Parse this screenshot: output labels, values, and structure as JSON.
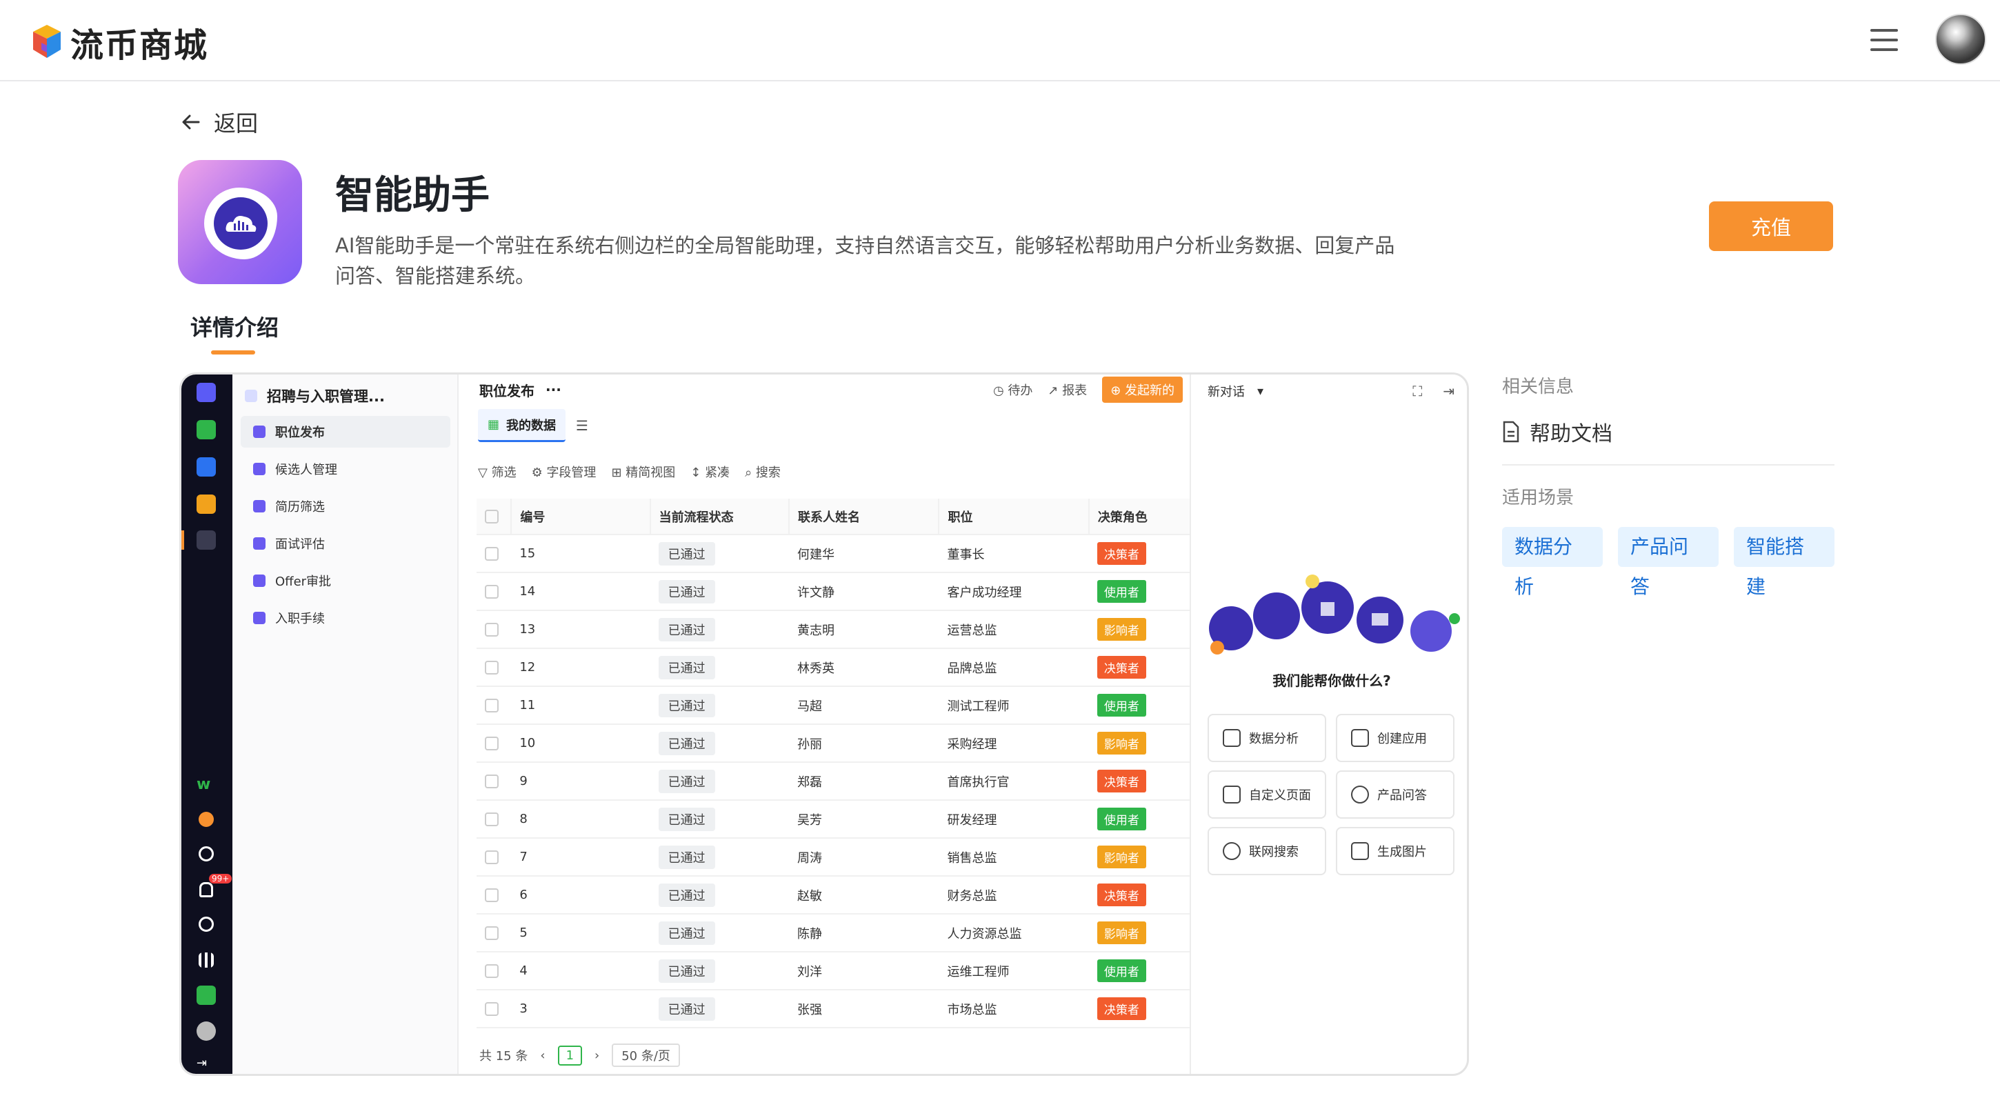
{
  "header": {
    "brand": "流币商城"
  },
  "back": {
    "label": "返回"
  },
  "app": {
    "title": "智能助手",
    "description": "AI智能助手是一个常驻在系统右侧边栏的全局智能助理，支持自然语言交互，能够轻松帮助用户分析业务数据、回复产品问答、智能搭建系统。",
    "recharge_label": "充值"
  },
  "tabs": {
    "detail": "详情介绍"
  },
  "side": {
    "related_heading": "相关信息",
    "doc_link": "帮助文档",
    "scene_heading": "适用场景",
    "tags": [
      "数据分析",
      "产品问答",
      "智能搭建"
    ]
  },
  "screenshot": {
    "nav_title": "招聘与入职管理...",
    "nav_items": [
      "职位发布",
      "候选人管理",
      "简历筛选",
      "面试评估",
      "Offer审批",
      "入职手续"
    ],
    "rail_badge": "99+",
    "page_title": "职位发布",
    "more": "···",
    "tools": {
      "todo": "待办",
      "report": "报表",
      "new": "发起新的"
    },
    "tab_my": "我的数据",
    "filters": [
      "筛选",
      "字段管理",
      "精简视图",
      "紧凑",
      "搜索"
    ],
    "columns": [
      "编号",
      "当前流程状态",
      "联系人姓名",
      "职位",
      "决策角色"
    ],
    "rows": [
      [
        "15",
        "已通过",
        "何建华",
        "董事长",
        "决策者"
      ],
      [
        "14",
        "已通过",
        "许文静",
        "客户成功经理",
        "使用者"
      ],
      [
        "13",
        "已通过",
        "黄志明",
        "运营总监",
        "影响者"
      ],
      [
        "12",
        "已通过",
        "林秀英",
        "品牌总监",
        "决策者"
      ],
      [
        "11",
        "已通过",
        "马超",
        "测试工程师",
        "使用者"
      ],
      [
        "10",
        "已通过",
        "孙丽",
        "采购经理",
        "影响者"
      ],
      [
        "9",
        "已通过",
        "郑磊",
        "首席执行官",
        "决策者"
      ],
      [
        "8",
        "已通过",
        "吴芳",
        "研发经理",
        "使用者"
      ],
      [
        "7",
        "已通过",
        "周涛",
        "销售总监",
        "影响者"
      ],
      [
        "6",
        "已通过",
        "赵敏",
        "财务总监",
        "决策者"
      ],
      [
        "5",
        "已通过",
        "陈静",
        "人力资源总监",
        "影响者"
      ],
      [
        "4",
        "已通过",
        "刘洋",
        "运维工程师",
        "使用者"
      ],
      [
        "3",
        "已通过",
        "张强",
        "市场总监",
        "决策者"
      ]
    ],
    "footer": {
      "total": "共 15 条",
      "page": "1",
      "page_size": "50 条/页"
    },
    "ai": {
      "new_chat": "新对话",
      "question": "我们能帮你做什么?",
      "cards": [
        "数据分析",
        "创建应用",
        "自定义页面",
        "产品问答",
        "联网搜索",
        "生成图片"
      ]
    }
  },
  "colors": {
    "accent": "#f7912f",
    "tag_bg": "#e6f3ff",
    "tag_text": "#1a6fd4",
    "decider": "#f25c2d",
    "user": "#2fb54a",
    "influencer": "#f2a21c"
  }
}
